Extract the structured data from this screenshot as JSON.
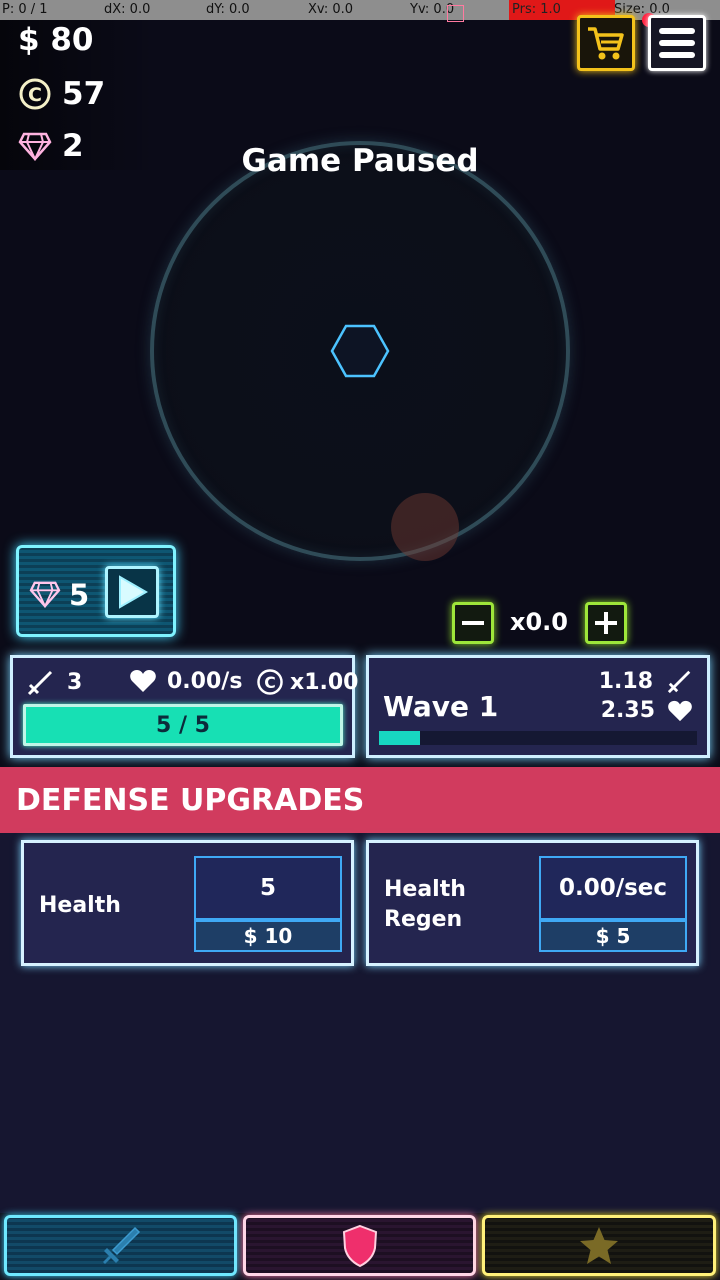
{
  "debug_bar": {
    "p": "P: 0 / 1",
    "dx": "dX: 0.0",
    "dy": "dY: 0.0",
    "xv": "Xv: 0.0",
    "yv": "Yv: 0.0",
    "prs": "Prs: 1.0",
    "size": "Size: 0.0"
  },
  "currency": {
    "cash": "$ 80",
    "coins": "57",
    "gems": "2"
  },
  "arena": {
    "status": "Game Paused"
  },
  "gem_skip": {
    "cost": "5"
  },
  "speed": {
    "value": "x0.0"
  },
  "player_stats": {
    "damage": "3",
    "regen": "0.00/s",
    "coin_multiplier": "x1.00",
    "health": "5 / 5",
    "health_fraction": 1.0
  },
  "wave": {
    "label": "Wave 1",
    "enemy_damage": "1.18",
    "enemy_health": "2.35",
    "progress_fraction": 0.13
  },
  "section": {
    "title": "DEFENSE UPGRADES"
  },
  "upgrades": [
    {
      "label_line1": "Health",
      "label_line2": "",
      "value": "5",
      "cost": "$ 10"
    },
    {
      "label_line1": "Health",
      "label_line2": "Regen",
      "value": "0.00/sec",
      "cost": "$ 5"
    }
  ],
  "nav": {
    "tabs": [
      {
        "icon": "sword-icon",
        "color": "#2b7fae"
      },
      {
        "icon": "shield-icon",
        "color": "#ef2f6c"
      },
      {
        "icon": "star-icon",
        "color": "#7a6a26"
      }
    ]
  },
  "colors": {
    "accent_cyan": "#7ff3ff",
    "health_green": "#17e0b4",
    "header_red": "#d13b5e",
    "shop_gold": "#f3c21b",
    "speed_green": "#9ee63a"
  }
}
